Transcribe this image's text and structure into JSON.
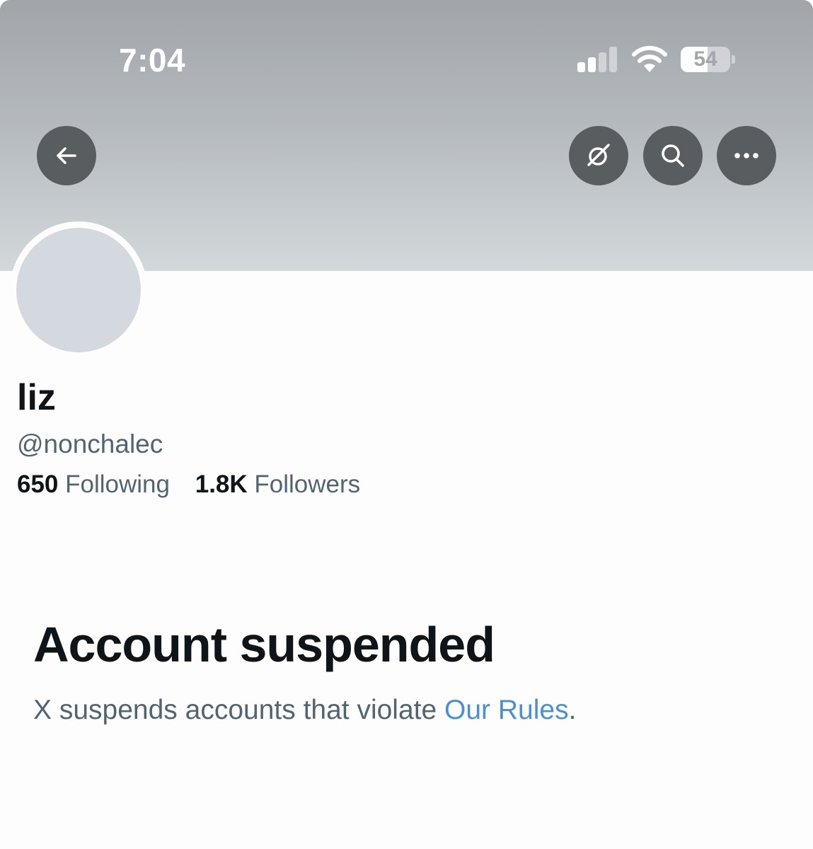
{
  "status_bar": {
    "time": "7:04",
    "battery_level": "54",
    "signal_bars_active": 2,
    "signal_bars_total": 4
  },
  "nav": {
    "back_icon": "arrow-left-icon",
    "grok_icon": "grok-slash-circle-icon",
    "search_icon": "search-icon",
    "more_icon": "more-horizontal-icon"
  },
  "profile": {
    "display_name": "liz",
    "handle": "@nonchalec",
    "following_count": "650",
    "following_label": "Following",
    "followers_count": "1.8K",
    "followers_label": "Followers"
  },
  "suspension": {
    "title": "Account suspended",
    "message_prefix": "X suspends accounts that violate ",
    "rules_link": "Our Rules",
    "message_suffix": "."
  },
  "colors": {
    "primary_text": "#0f1419",
    "secondary_text": "#536471",
    "link": "#4a90d0",
    "button_bg": "#5a5d60",
    "avatar_placeholder": "#d3d9de"
  }
}
